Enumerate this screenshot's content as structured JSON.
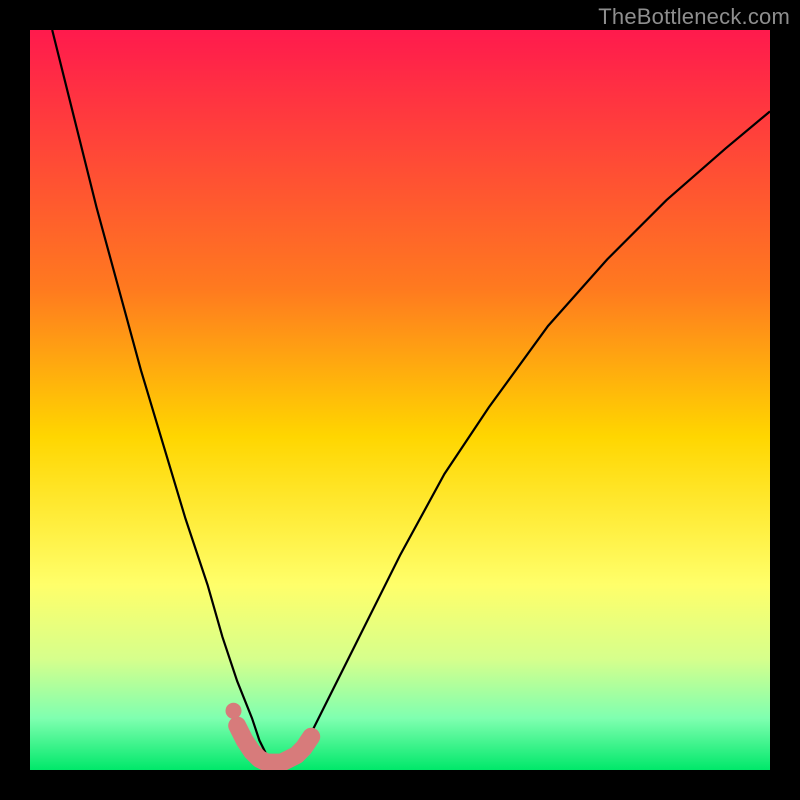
{
  "watermark": "TheBottleneck.com",
  "chart_data": {
    "type": "line",
    "title": "",
    "xlabel": "",
    "ylabel": "",
    "xlim": [
      0,
      100
    ],
    "ylim": [
      0,
      100
    ],
    "gradient_stops": [
      {
        "offset": 0,
        "color": "#ff1a4d"
      },
      {
        "offset": 35,
        "color": "#ff7a1f"
      },
      {
        "offset": 55,
        "color": "#ffd600"
      },
      {
        "offset": 75,
        "color": "#ffff6a"
      },
      {
        "offset": 85,
        "color": "#d6ff8c"
      },
      {
        "offset": 93,
        "color": "#7fffb0"
      },
      {
        "offset": 100,
        "color": "#00e86a"
      }
    ],
    "series": [
      {
        "name": "bottleneck-curve",
        "x": [
          3,
          6,
          9,
          12,
          15,
          18,
          21,
          24,
          26,
          28,
          30,
          31,
          32,
          33,
          34,
          36,
          38,
          40,
          44,
          50,
          56,
          62,
          70,
          78,
          86,
          94,
          100
        ],
        "y": [
          100,
          88,
          76,
          65,
          54,
          44,
          34,
          25,
          18,
          12,
          7,
          4,
          2,
          1,
          1,
          2,
          5,
          9,
          17,
          29,
          40,
          49,
          60,
          69,
          77,
          84,
          89
        ]
      }
    ],
    "highlight_segment": {
      "name": "optimal-range",
      "color": "#d77b7b",
      "x": [
        28,
        29,
        30,
        31,
        32,
        33,
        34,
        35,
        36,
        37,
        38
      ],
      "y": [
        6,
        4,
        2.5,
        1.5,
        1,
        1,
        1,
        1.5,
        2,
        3,
        4.5
      ]
    },
    "highlight_point": {
      "x": 27.5,
      "y": 8,
      "color": "#d77b7b"
    }
  }
}
